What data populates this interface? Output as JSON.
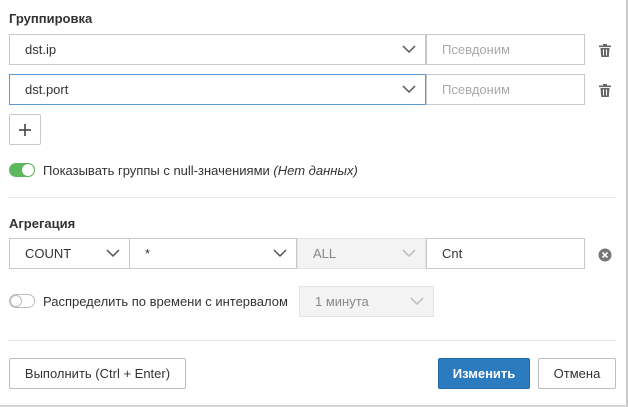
{
  "grouping": {
    "title": "Группировка",
    "rows": [
      {
        "field": "dst.ip",
        "alias_placeholder": "Псевдоним"
      },
      {
        "field": "dst.port",
        "alias_placeholder": "Псевдоним"
      }
    ],
    "null_toggle": {
      "label": "Показывать группы с null-значениями",
      "note": "(Нет данных)",
      "enabled": true
    }
  },
  "aggregation": {
    "title": "Агрегация",
    "function": "COUNT",
    "field": "*",
    "mode": "ALL",
    "alias": "Cnt",
    "time_toggle": {
      "label": "Распределить по времени с интервалом",
      "enabled": false,
      "interval": "1 минута"
    }
  },
  "footer": {
    "run_label": "Выполнить (Ctrl + Enter)",
    "apply_label": "Изменить",
    "cancel_label": "Отмена"
  },
  "colors": {
    "primary": "#2d7bbf",
    "toggle_on": "#5cb85c"
  }
}
